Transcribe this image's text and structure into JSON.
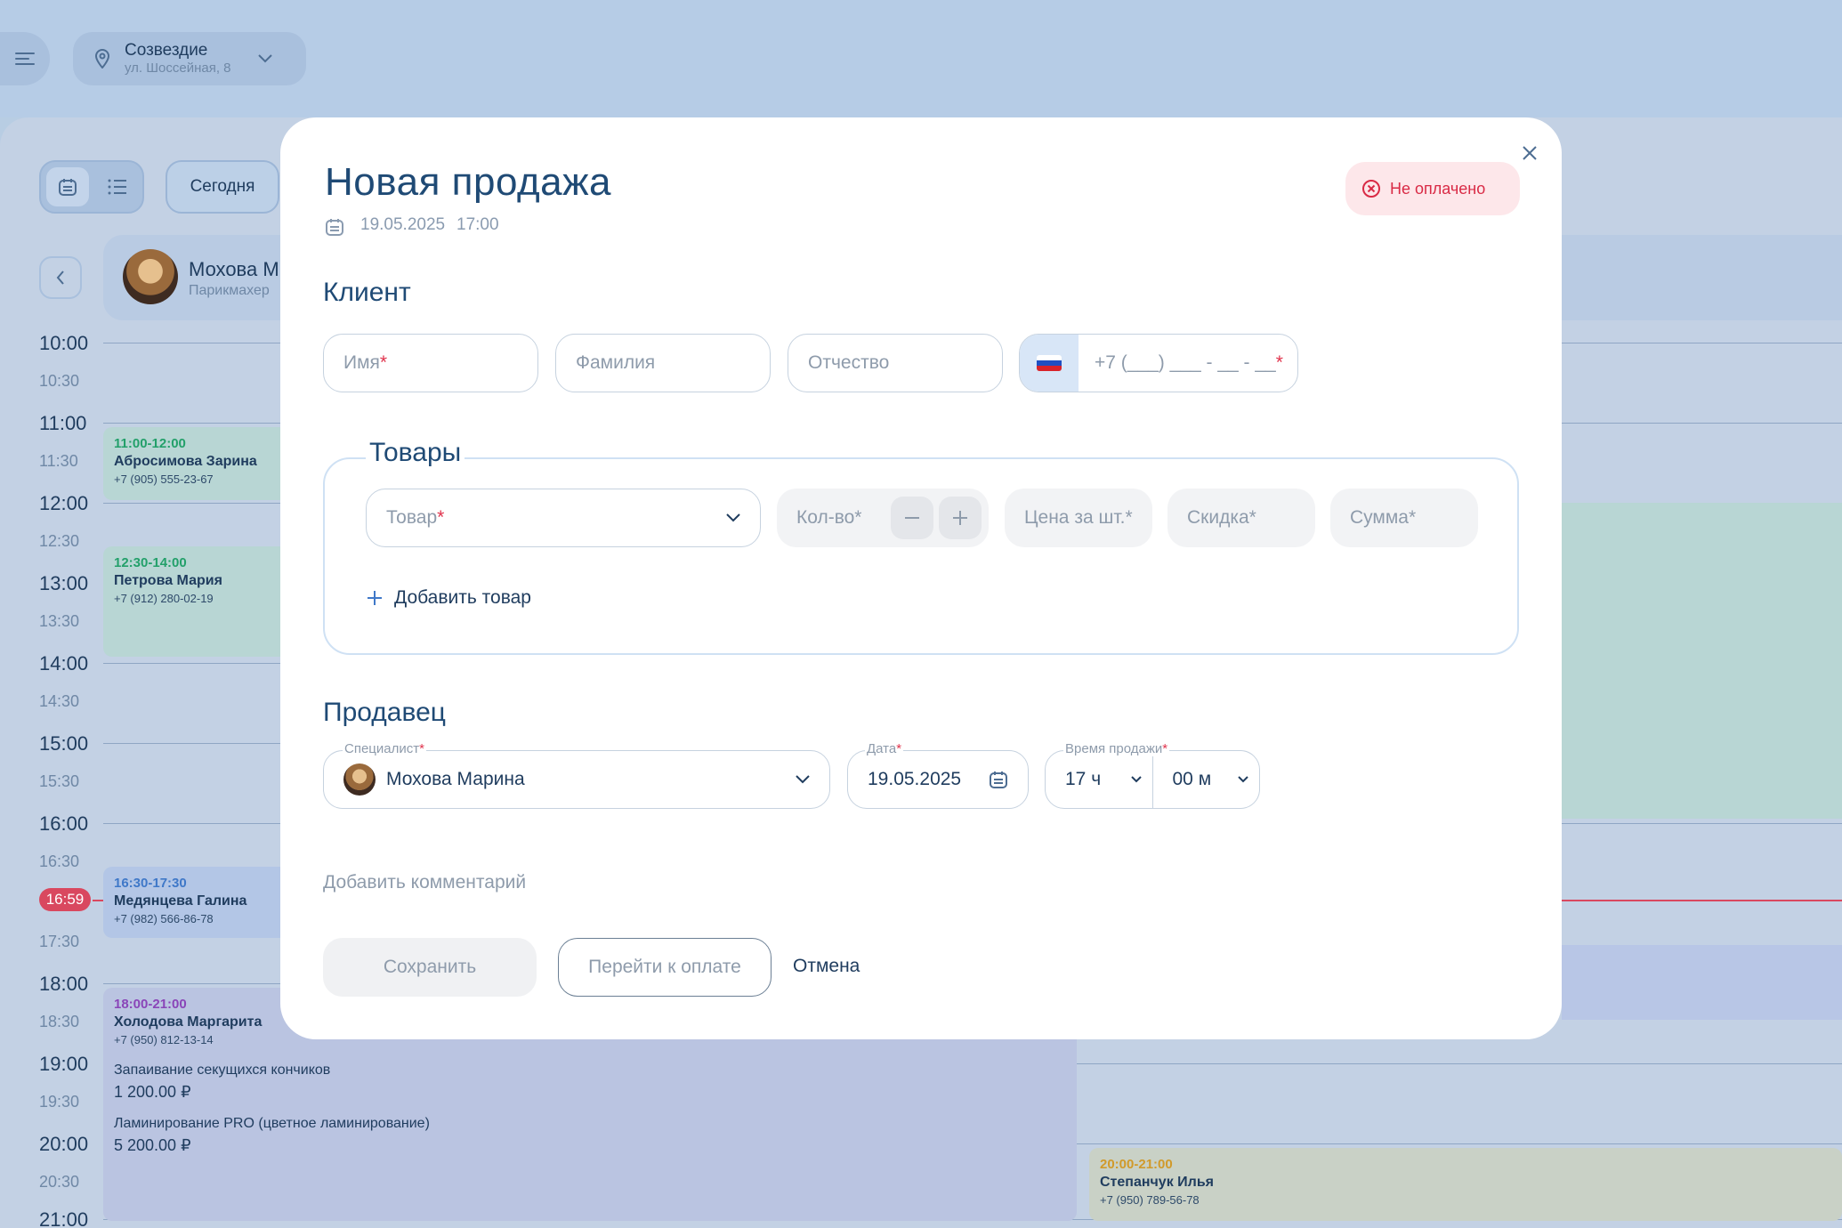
{
  "location": {
    "name": "Созвездие",
    "address": "ул. Шоссейная, 8"
  },
  "toolbar": {
    "today_label": "Сегодня"
  },
  "master": {
    "name": "Мохова М",
    "role": "Парикмахер"
  },
  "time_labels": [
    "10:00",
    "10:30",
    "11:00",
    "11:30",
    "12:00",
    "12:30",
    "13:00",
    "13:30",
    "14:00",
    "14:30",
    "15:00",
    "15:30",
    "16:00",
    "16:30",
    "17:30",
    "18:00",
    "18:30",
    "19:00",
    "19:30",
    "20:00",
    "20:30",
    "21:00"
  ],
  "now_time": "16:59",
  "appointments": [
    {
      "time": "11:00-12:00",
      "name": "Абросимова Зарина",
      "phone": "+7 (905) 555-23-67"
    },
    {
      "time": "12:30-14:00",
      "name": "Петрова Мария",
      "phone": "+7 (912) 280-02-19"
    },
    {
      "time": "16:30-17:30",
      "name": "Медянцева Галина",
      "phone": "+7 (982) 566-86-78"
    },
    {
      "time": "18:00-21:00",
      "name": "Холодова Маргарита",
      "phone": "+7 (950) 812-13-14",
      "services": [
        {
          "name": "Запаивание секущихся кончиков",
          "price": "1 200.00 ₽"
        },
        {
          "name": "Ламинирование PRO (цветное ламинирование)",
          "price": "5 200.00 ₽"
        }
      ]
    },
    {
      "time": "20:00-21:00",
      "name": "Степанчук Илья",
      "phone": "+7 (950) 789-56-78"
    }
  ],
  "modal": {
    "title": "Новая продажа",
    "date": "19.05.2025",
    "time": "17:00",
    "status": "Не оплачено",
    "client": {
      "section_title": "Клиент",
      "first_name_placeholder": "Имя",
      "last_name_placeholder": "Фамилия",
      "middle_name_placeholder": "Отчество",
      "phone_placeholder": "+7 (___) ___ - __ - __",
      "required_mark": "*"
    },
    "goods": {
      "section_title": "Товары",
      "product_placeholder": "Товар",
      "qty_placeholder": "Кол-во*",
      "price_placeholder": "Цена за шт.*",
      "discount_placeholder": "Скидка*",
      "sum_placeholder": "Сумма*",
      "add_label": "Добавить товар"
    },
    "seller": {
      "section_title": "Продавец",
      "specialist_label": "Специалист",
      "specialist_value": "Мохова Марина",
      "date_label": "Дата",
      "date_value": "19.05.2025",
      "time_label": "Время продажи",
      "hours_value": "17 ч",
      "minutes_value": "00 м"
    },
    "comment_label": "Добавить комментарий",
    "buttons": {
      "save": "Сохранить",
      "pay": "Перейти к оплате",
      "cancel": "Отмена"
    }
  },
  "colors": {
    "accent": "#1f4a75",
    "status_bg": "#fde7ea",
    "status_fg": "#d92a45",
    "required": "#e0344d",
    "now_line": "#d9485f"
  }
}
